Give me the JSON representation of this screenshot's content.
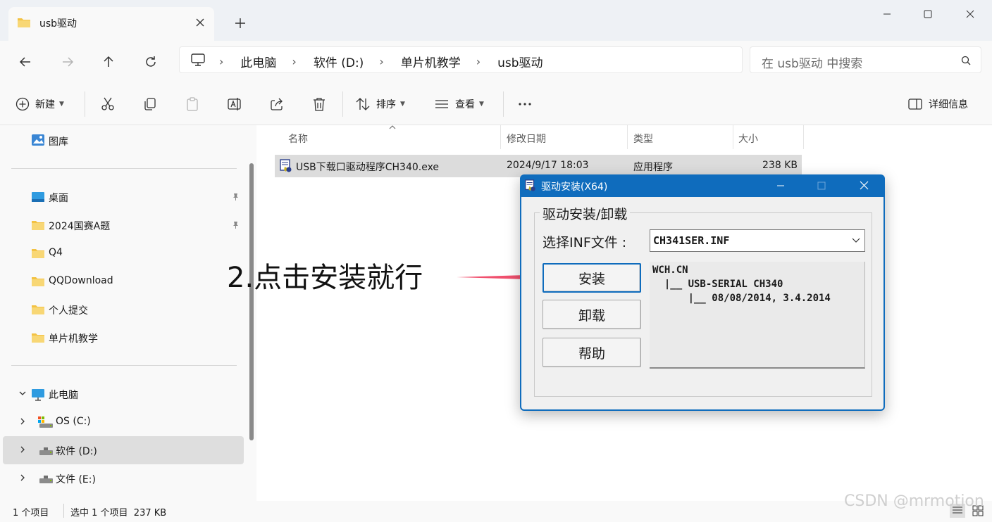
{
  "tab": {
    "title": "usb驱动"
  },
  "address": {
    "crumbs": [
      "此电脑",
      "软件 (D:)",
      "单片机教学",
      "usb驱动"
    ],
    "search_placeholder": "在 usb驱动 中搜索"
  },
  "toolbar": {
    "new_label": "新建",
    "sort_label": "排序",
    "view_label": "查看",
    "details_label": "详细信息"
  },
  "sidebar": {
    "gallery": "图库",
    "pinned": [
      "桌面",
      "2024国赛A题",
      "Q4",
      "QQDownload",
      "个人提交",
      "单片机教学"
    ],
    "this_pc": "此电脑",
    "drives": [
      "OS (C:)",
      "软件 (D:)",
      "文件 (E:)"
    ]
  },
  "filelist": {
    "columns": [
      "名称",
      "修改日期",
      "类型",
      "大小"
    ],
    "rows": [
      {
        "name": "USB下载口驱动程序CH340.exe",
        "modified": "2024/9/17 18:03",
        "type": "应用程序",
        "size": "238 KB"
      }
    ]
  },
  "status": {
    "count": "1 个项目",
    "selection": "选中 1 个项目  237 KB"
  },
  "annotation": "2.点击安装就行",
  "watermark": "CSDN @mrmotion",
  "dialog": {
    "title": "驱动安装(X64)",
    "group_title": "驱动安装/卸载",
    "inf_label": "选择INF文件 :",
    "inf_value": "CH341SER.INF",
    "install_button": "安装",
    "uninstall_button": "卸载",
    "help_button": "帮助",
    "info_lines": [
      "WCH.CN",
      "  |__ USB-SERIAL CH340",
      "      |__ 08/08/2014, 3.4.2014"
    ]
  },
  "colors": {
    "accent": "#0f6cbd",
    "folder": "#f3c243",
    "arrow": "#f0506e"
  }
}
